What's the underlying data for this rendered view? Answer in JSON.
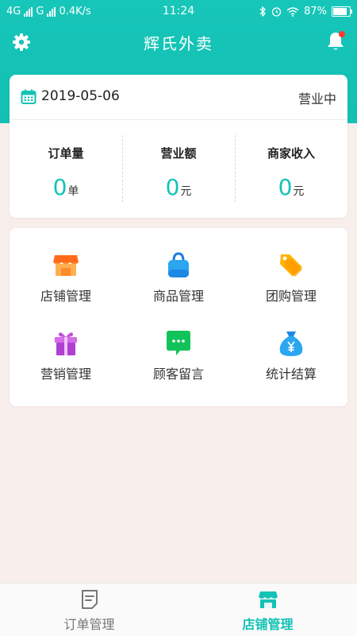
{
  "status_bar": {
    "network1": "4G",
    "network2": "G",
    "speed": "0.4K/s",
    "time": "11:24",
    "battery": "87%",
    "battery_level": 0.87
  },
  "header": {
    "title": "辉氏外卖",
    "settings_icon": "gear-icon",
    "bell_icon": "bell-icon",
    "badge_color": "#ff3b30"
  },
  "summary": {
    "date": "2019-05-06",
    "status": "营业中",
    "stats": [
      {
        "label": "订单量",
        "value": "0",
        "unit": "单"
      },
      {
        "label": "营业额",
        "value": "0",
        "unit": "元"
      },
      {
        "label": "商家收入",
        "value": "0",
        "unit": "元"
      }
    ]
  },
  "menu": {
    "items": [
      {
        "label": "店铺管理",
        "icon": "store-icon"
      },
      {
        "label": "商品管理",
        "icon": "shopping-bag-icon"
      },
      {
        "label": "团购管理",
        "icon": "price-tag-icon"
      },
      {
        "label": "营销管理",
        "icon": "gift-icon"
      },
      {
        "label": "顾客留言",
        "icon": "message-icon"
      },
      {
        "label": "统计结算",
        "icon": "money-bag-icon"
      }
    ]
  },
  "tabbar": {
    "tabs": [
      {
        "label": "订单管理",
        "icon": "order-document-icon",
        "active": false
      },
      {
        "label": "店铺管理",
        "icon": "store-icon",
        "active": true
      }
    ]
  },
  "colors": {
    "accent": "#14c2b6",
    "background": "#f8efed"
  }
}
